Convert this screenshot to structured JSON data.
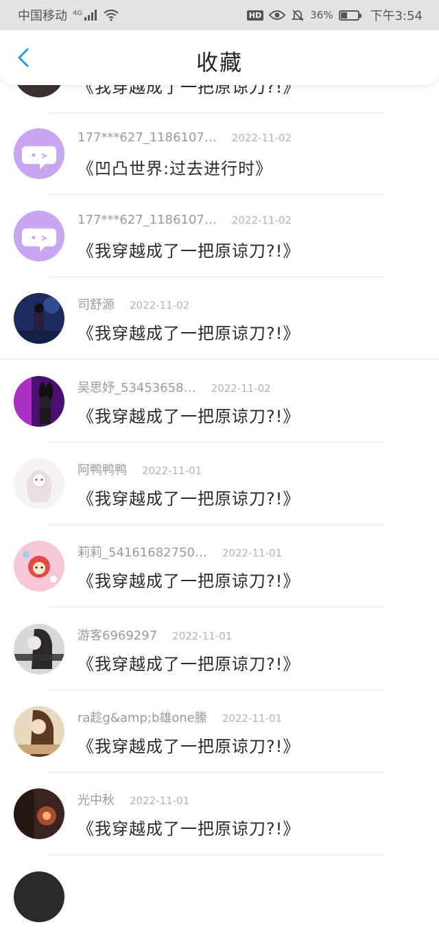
{
  "status": {
    "carrier": "中国移动",
    "network": "4G",
    "battery": "36%",
    "battery_level": 0.36,
    "time": "下午3:54",
    "hd_label": "HD"
  },
  "header": {
    "title": "收藏"
  },
  "items": [
    {
      "user": "",
      "date": "",
      "book": "《我穿越成了一把原谅刀?!》",
      "avatar_color": "#3b3230"
    },
    {
      "user": "177***627_1186107…",
      "date": "2022-11-02",
      "book": "《凹凸世界:过去进行时》",
      "avatar_color": "#c9a6f2"
    },
    {
      "user": "177***627_1186107…",
      "date": "2022-11-02",
      "book": "《我穿越成了一把原谅刀?!》",
      "avatar_color": "#c9a6f2"
    },
    {
      "user": "司舒源",
      "date": "2022-11-02",
      "book": "《我穿越成了一把原谅刀?!》",
      "avatar_color": "#1c2a5e"
    },
    {
      "user": "吴思妤_53453658…",
      "date": "2022-11-02",
      "book": "《我穿越成了一把原谅刀?!》",
      "avatar_color": "#4b0f6e"
    },
    {
      "user": "阿鸭鸭鸭",
      "date": "2022-11-01",
      "book": "《我穿越成了一把原谅刀?!》",
      "avatar_color": "#f3eef0"
    },
    {
      "user": "莉莉_54161682750…",
      "date": "2022-11-01",
      "book": "《我穿越成了一把原谅刀?!》",
      "avatar_color": "#f6c8d6"
    },
    {
      "user": "游客6969297",
      "date": "2022-11-01",
      "book": "《我穿越成了一把原谅刀?!》",
      "avatar_color": "#6f6f6f"
    },
    {
      "user": "ra趁g&amp;b雄one縢",
      "date": "2022-11-01",
      "book": "《我穿越成了一把原谅刀?!》",
      "avatar_color": "#b88a5a"
    },
    {
      "user": "光中秋",
      "date": "2022-11-01",
      "book": "《我穿越成了一把原谅刀?!》",
      "avatar_color": "#3a2320"
    },
    {
      "user": "",
      "date": "",
      "book": "",
      "avatar_color": "#2a2a2a"
    }
  ]
}
